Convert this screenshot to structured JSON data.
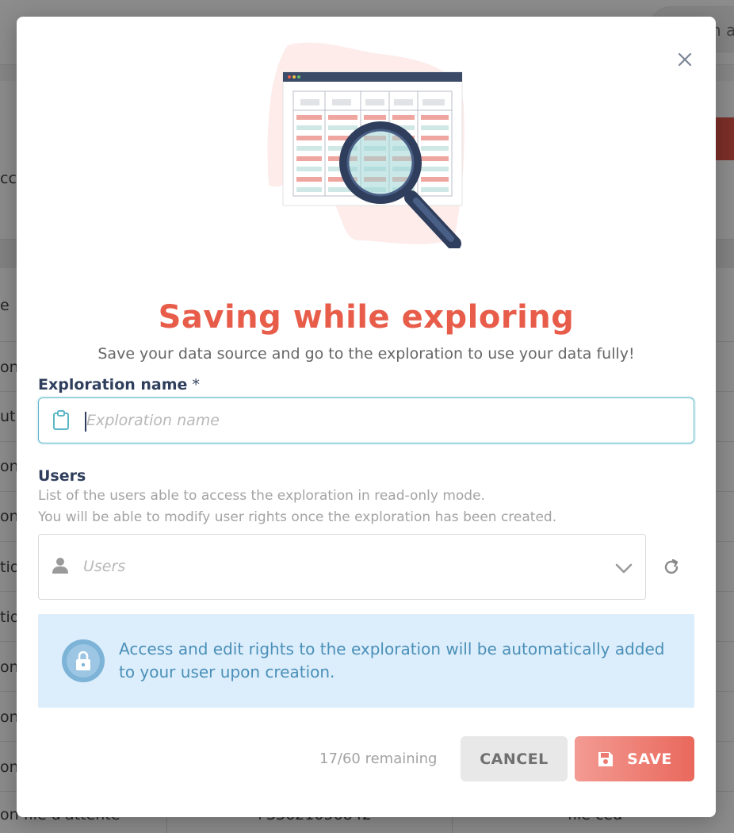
{
  "background": {
    "search_fragment": "h a",
    "side_fragments": [
      "cc",
      "e",
      "on",
      "uti",
      "on",
      "on",
      "tio",
      "tio",
      "on",
      "on",
      "on"
    ],
    "bottom_row": [
      "on file d'attente",
      "+33621056842",
      "file ced"
    ]
  },
  "modal": {
    "title": "Saving while exploring",
    "subtitle": "Save your data source and go to the exploration to use your data fully!",
    "exploration_field": {
      "label": "Exploration name",
      "required_marker": "*",
      "placeholder": "Exploration name",
      "value": "",
      "icon": "clipboard-icon"
    },
    "users_field": {
      "label": "Users",
      "help_line_1": "List of the users able to access the exploration in read-only mode.",
      "help_line_2": "You will be able to modify user rights once the exploration has been created.",
      "placeholder": "Users",
      "icon": "user-icon"
    },
    "info": {
      "text": "Access and edit rights to the exploration will be automatically added to your user upon creation.",
      "icon": "lock-icon"
    },
    "footer": {
      "remaining": "17/60 remaining",
      "cancel_label": "CANCEL",
      "save_label": "SAVE"
    }
  },
  "colors": {
    "accent": "#e85c4a",
    "label": "#2f3e5c",
    "input_focus": "#5cb7c7",
    "info_bg": "#dcedfb",
    "info_text": "#4a90b8"
  }
}
